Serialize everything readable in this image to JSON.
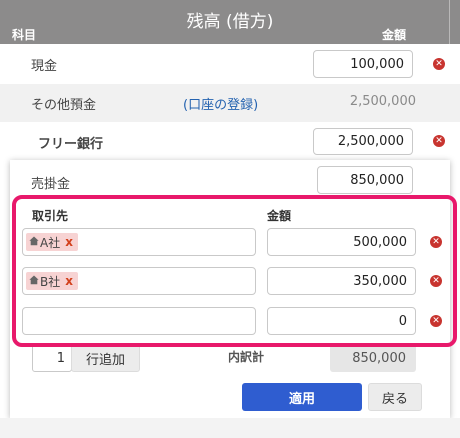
{
  "header": {
    "title": "残高 (借方)",
    "left_label": "科目",
    "right_label": "金額"
  },
  "rows": [
    {
      "label": "現金",
      "value": "100,000"
    },
    {
      "label": "その他預金",
      "link": "(口座の登録)",
      "value": "2,500,000"
    },
    {
      "label": "フリー銀行",
      "value": "2,500,000"
    },
    {
      "label": "売掛金",
      "value": "850,000"
    }
  ],
  "popup": {
    "col_partner": "取引先",
    "col_amount": "金額",
    "entries": [
      {
        "partner": "A社",
        "amount": "500,000"
      },
      {
        "partner": "B社",
        "amount": "350,000"
      },
      {
        "partner": "",
        "amount": "0"
      }
    ],
    "remove_tag": "x",
    "add_count": "1",
    "add_button": "行追加",
    "subtotal_label": "内訳計",
    "subtotal_value": "850,000",
    "apply_button": "適用",
    "back_button": "戻る"
  },
  "colors": {
    "header_bg": "#8c8b8b",
    "highlight": "#e8196b",
    "apply_bg": "#2f5dd0",
    "delete_icon": "#c8342f",
    "tag_bg": "#f7d3d3"
  }
}
